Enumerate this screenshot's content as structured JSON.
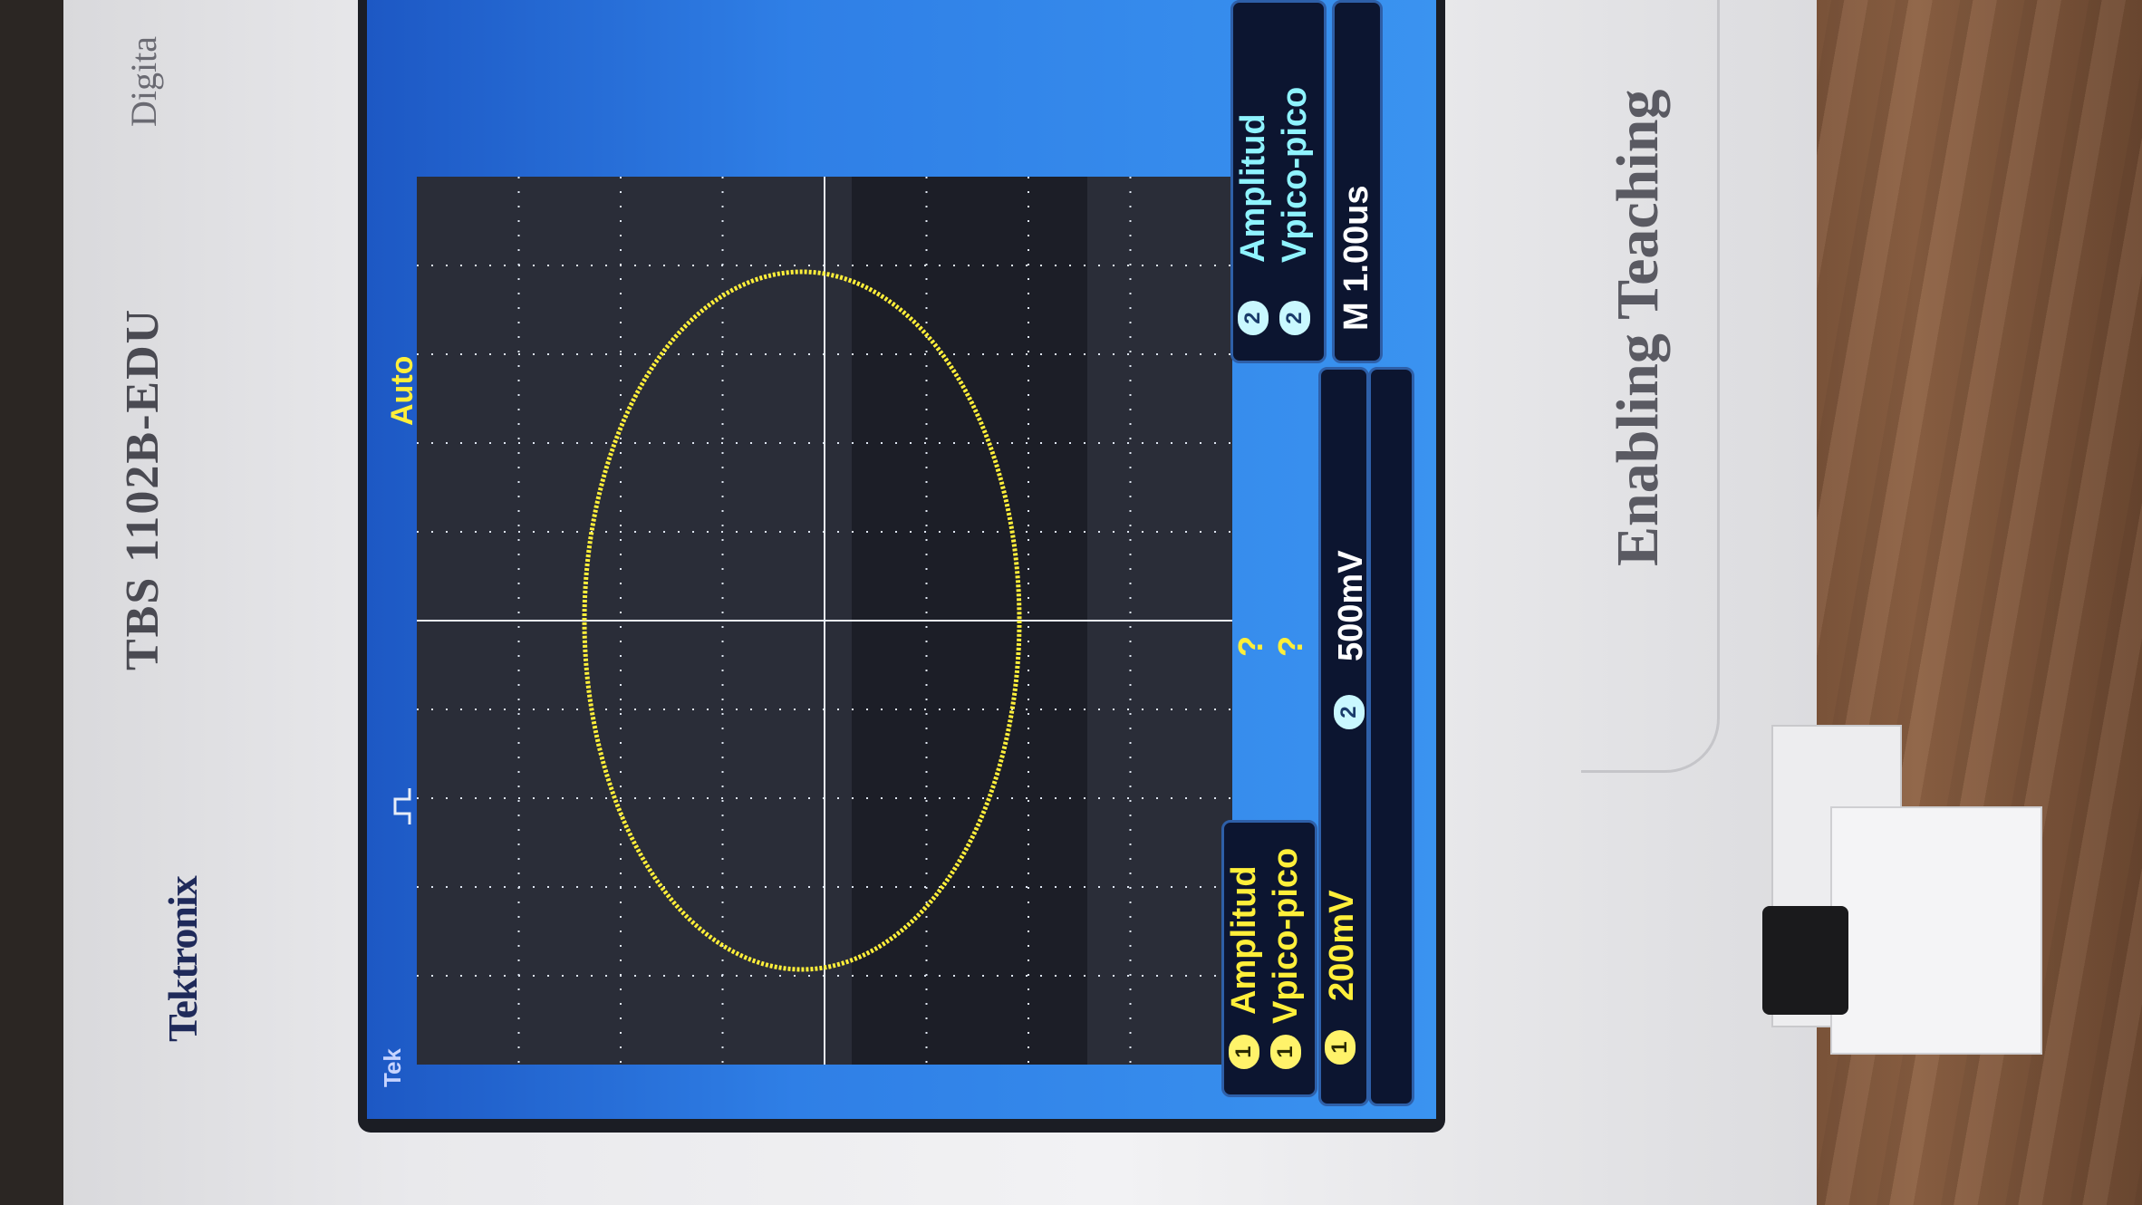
{
  "device": {
    "brand": "Tektronix",
    "model": "TBS 1102B-EDU",
    "model_suffix": "Digita",
    "tagline": "Enabling Teaching"
  },
  "screen": {
    "trigger_mode": "Auto",
    "ch1_measurements": [
      {
        "label": "Amplitud",
        "value": "?"
      },
      {
        "label": "Vpico-pico",
        "value": "?"
      }
    ],
    "ch2_measurements": [
      {
        "label": "Amplitud"
      },
      {
        "label": "Vpico-pico"
      }
    ],
    "ch1_scale": "200mV",
    "ch2_scale": "500mV",
    "timebase": "M 1.00us",
    "channel1": "1",
    "channel2": "2",
    "corner_label": "Tek"
  },
  "colors": {
    "trace": "#ffef3a",
    "ch1": "#ffef3a",
    "ch2": "#8ff3ff",
    "screen_blue": "#2f7fe6",
    "graticule_bg": "#2a2d38"
  }
}
